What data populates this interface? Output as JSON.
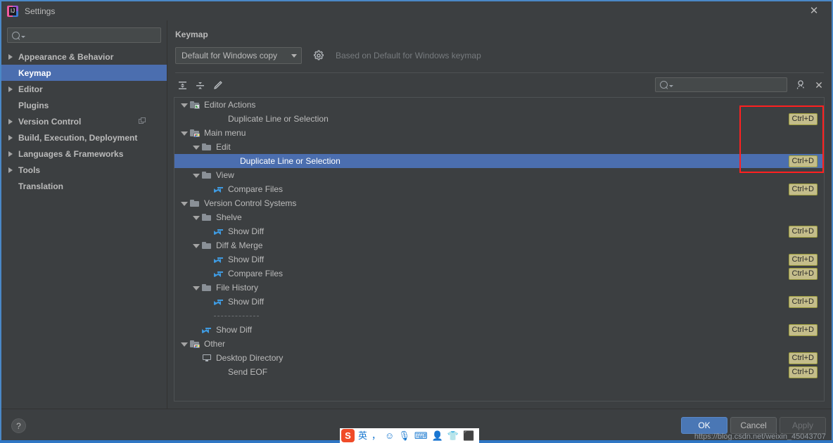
{
  "window": {
    "title": "Settings",
    "app_icon": "intellij-idea-icon",
    "close_label": "✕",
    "border_color": "#4a88c7"
  },
  "sidebar": {
    "search": {
      "value": "",
      "placeholder": "",
      "icon": "search-icon"
    },
    "items": [
      {
        "label": "Appearance & Behavior",
        "expandable": true,
        "selected": false,
        "extra_icon": null
      },
      {
        "label": "Keymap",
        "expandable": false,
        "selected": true,
        "extra_icon": null
      },
      {
        "label": "Editor",
        "expandable": true,
        "selected": false,
        "extra_icon": null
      },
      {
        "label": "Plugins",
        "expandable": false,
        "selected": false,
        "extra_icon": null
      },
      {
        "label": "Version Control",
        "expandable": true,
        "selected": false,
        "extra_icon": "copy-icon"
      },
      {
        "label": "Build, Execution, Deployment",
        "expandable": true,
        "selected": false,
        "extra_icon": null
      },
      {
        "label": "Languages & Frameworks",
        "expandable": true,
        "selected": false,
        "extra_icon": null
      },
      {
        "label": "Tools",
        "expandable": true,
        "selected": false,
        "extra_icon": null
      },
      {
        "label": "Translation",
        "expandable": false,
        "selected": false,
        "extra_icon": null
      }
    ]
  },
  "main": {
    "title": "Keymap",
    "keymap_select": {
      "value": "Default for Windows copy",
      "icon": "chevron-down-icon"
    },
    "gear_icon": "gear-icon",
    "based_on": "Based on Default for Windows keymap",
    "toolbar": {
      "expand_all": "expand-all-icon",
      "collapse_all": "collapse-all-icon",
      "edit": "edit-pencil-icon"
    },
    "filter": {
      "search": {
        "value": "",
        "placeholder": "",
        "icon": "search-icon"
      },
      "shortcut_filter_icon": "filter-by-shortcut-icon",
      "clear_label": "✕"
    },
    "tree": [
      {
        "label": "Editor Actions",
        "depth": 0,
        "arrow": "open",
        "icon": "folder-green-icon",
        "shortcut": null,
        "selected": false
      },
      {
        "label": "Duplicate Line or Selection",
        "depth": 2,
        "arrow": null,
        "icon": null,
        "shortcut": "Ctrl+D",
        "selected": false
      },
      {
        "label": "Main menu",
        "depth": 0,
        "arrow": "open",
        "icon": "folder-menu-icon",
        "shortcut": null,
        "selected": false
      },
      {
        "label": "Edit",
        "depth": 1,
        "arrow": "open",
        "icon": "folder-icon",
        "shortcut": null,
        "selected": false
      },
      {
        "label": "Duplicate Line or Selection",
        "depth": 3,
        "arrow": null,
        "icon": null,
        "shortcut": "Ctrl+D",
        "selected": true
      },
      {
        "label": "View",
        "depth": 1,
        "arrow": "open",
        "icon": "folder-icon",
        "shortcut": null,
        "selected": false
      },
      {
        "label": "Compare Files",
        "depth": 2,
        "arrow": null,
        "icon": "diff-arrows-icon",
        "shortcut": "Ctrl+D",
        "selected": false
      },
      {
        "label": "Version Control Systems",
        "depth": 0,
        "arrow": "open",
        "icon": "folder-icon",
        "shortcut": null,
        "selected": false
      },
      {
        "label": "Shelve",
        "depth": 1,
        "arrow": "open",
        "icon": "folder-icon",
        "shortcut": null,
        "selected": false
      },
      {
        "label": "Show Diff",
        "depth": 2,
        "arrow": null,
        "icon": "diff-arrows-icon",
        "shortcut": "Ctrl+D",
        "selected": false
      },
      {
        "label": "Diff & Merge",
        "depth": 1,
        "arrow": "open",
        "icon": "folder-icon",
        "shortcut": null,
        "selected": false
      },
      {
        "label": "Show Diff",
        "depth": 2,
        "arrow": null,
        "icon": "diff-arrows-icon",
        "shortcut": "Ctrl+D",
        "selected": false
      },
      {
        "label": "Compare Files",
        "depth": 2,
        "arrow": null,
        "icon": "diff-arrows-icon",
        "shortcut": "Ctrl+D",
        "selected": false
      },
      {
        "label": "File History",
        "depth": 1,
        "arrow": "open",
        "icon": "folder-icon",
        "shortcut": null,
        "selected": false
      },
      {
        "label": "Show Diff",
        "depth": 2,
        "arrow": null,
        "icon": "diff-arrows-icon",
        "shortcut": "Ctrl+D",
        "selected": false
      },
      {
        "label": "",
        "depth": 2,
        "arrow": null,
        "icon": "separator",
        "shortcut": null,
        "selected": false
      },
      {
        "label": "Show Diff",
        "depth": 1,
        "arrow": null,
        "icon": "diff-arrows-icon",
        "shortcut": "Ctrl+D",
        "selected": false
      },
      {
        "label": "Other",
        "depth": 0,
        "arrow": "open",
        "icon": "folder-menu-icon",
        "shortcut": null,
        "selected": false
      },
      {
        "label": "Desktop Directory",
        "depth": 1,
        "arrow": null,
        "icon": "monitor-icon",
        "shortcut": "Ctrl+D",
        "selected": false
      },
      {
        "label": "Send EOF",
        "depth": 2,
        "arrow": null,
        "icon": null,
        "shortcut": "Ctrl+D",
        "selected": false
      }
    ],
    "annotation": {
      "type": "red-highlight-box",
      "color": "#ff2020"
    }
  },
  "footer": {
    "help_label": "?",
    "ok_label": "OK",
    "cancel_label": "Cancel",
    "apply_label": "Apply",
    "watermark": "https://blog.csdn.net/weixin_45043707"
  },
  "ime_bar": {
    "logo": "S",
    "icons": [
      "英",
      "，",
      "☺",
      "🎙",
      "⌨",
      "👤",
      "👕",
      "⬛"
    ]
  }
}
